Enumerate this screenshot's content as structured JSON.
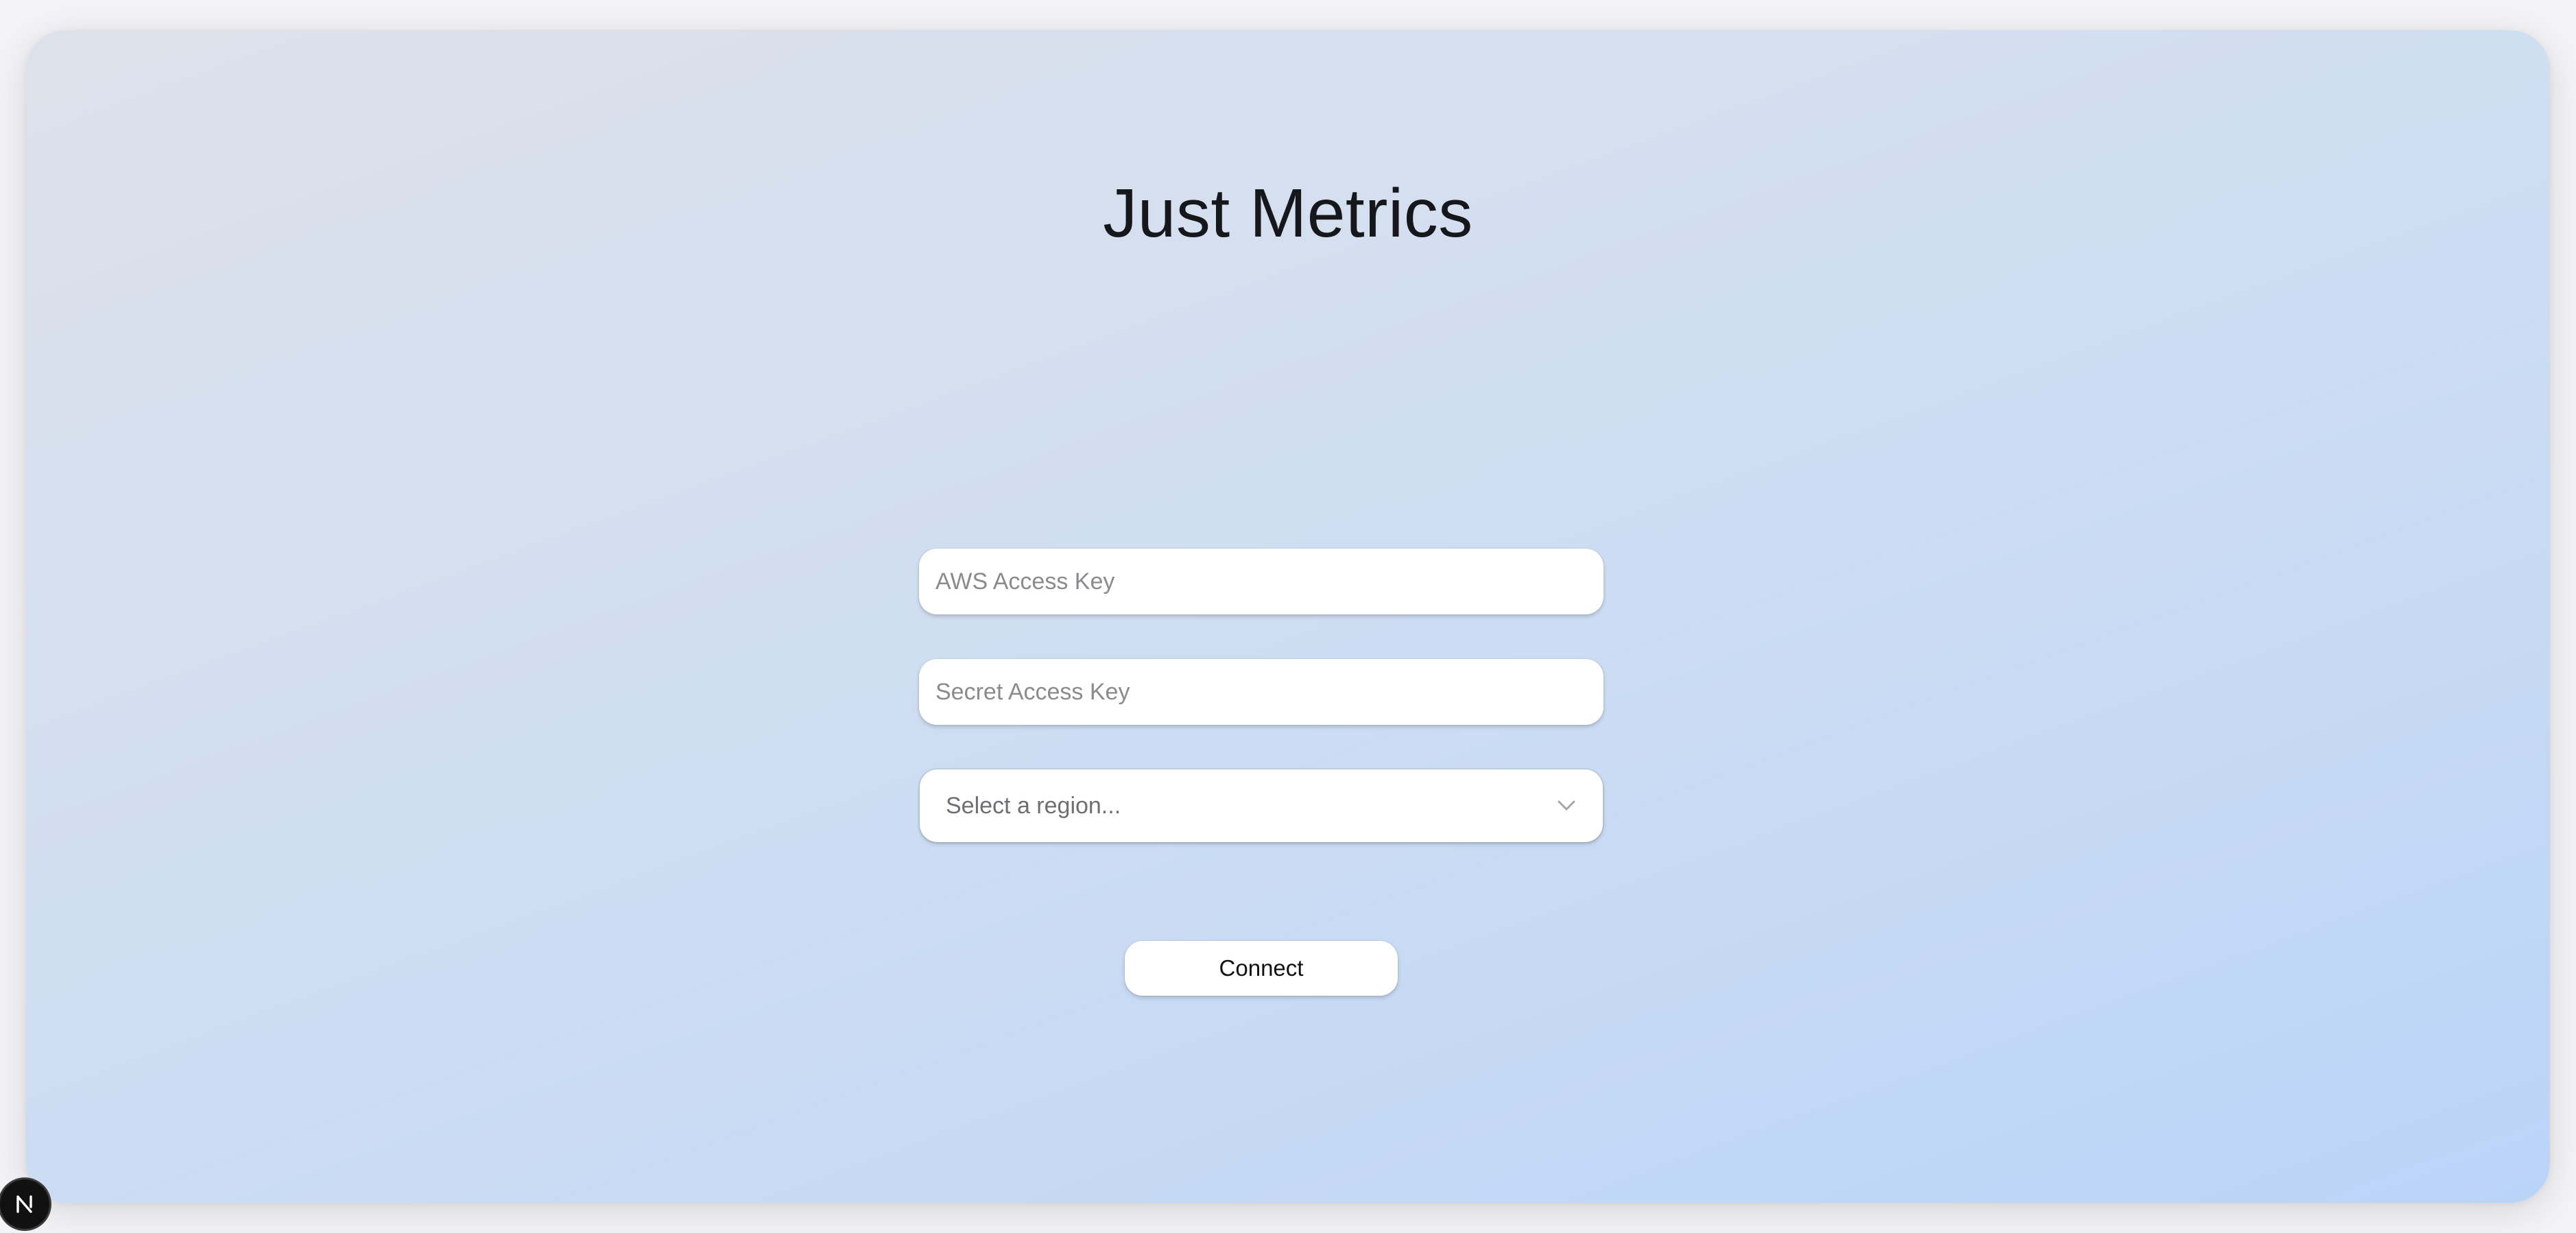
{
  "app": {
    "title": "Just Metrics"
  },
  "form": {
    "access_key_placeholder": "AWS Access Key",
    "access_key_value": "",
    "secret_key_placeholder": "Secret Access Key",
    "secret_key_value": "",
    "region_select_value": "Select a region...",
    "connect_label": "Connect"
  },
  "badge": {
    "letter": "N",
    "icon": "nextjs-logo-icon"
  },
  "colors": {
    "gradient_start": "#dde1ea",
    "gradient_end": "#bad4f8",
    "title_text": "#16171b",
    "placeholder_text": "#8a8a8f"
  }
}
